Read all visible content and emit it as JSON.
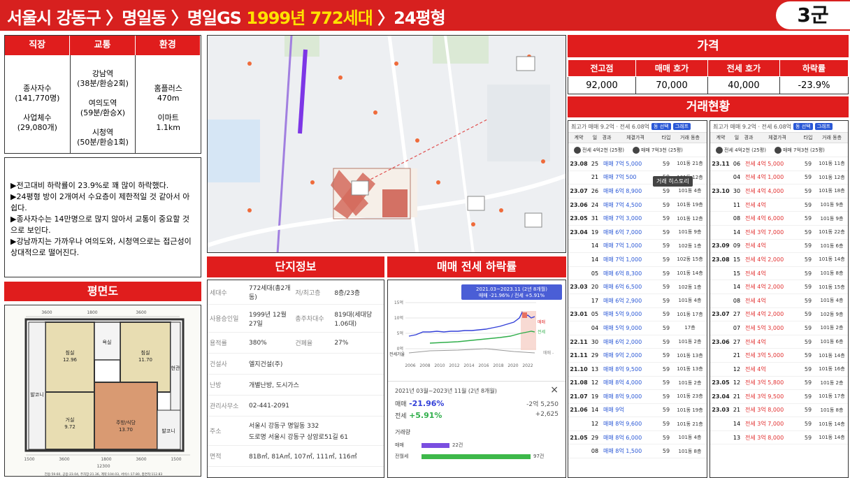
{
  "header": {
    "title_part1": "서울시 강동구 〉명일동 〉명일GS ",
    "title_highlight": "1999년 772세대",
    "title_part2": " 〉24평형",
    "group_badge": "3군"
  },
  "categories": {
    "headers": [
      "직장",
      "교통",
      "환경"
    ],
    "job": "종사자수\n(141,770명)\n\n사업체수\n(29,080개)",
    "transport": "강남역\n(38분/환승2회)\n\n여의도역\n(59분/환승X)\n\n시청역\n(50분/환승1회)",
    "environment": "홈플러스\n470m\n\n이마트\n1.1km"
  },
  "comment": {
    "lines": [
      "▶전고대비 하락률이 23.9%로 꽤 많이 하락했다.",
      "▶24평형 방이 2개여서 수요층이 제한적일 것 같아서 아쉽다.",
      "▶종사자수는 14만명으로 많지 않아서 교통이 중요할 것으로 보인다.",
      "▶강남까지는 가까우나 여의도와, 시청역으로는 접근성이 상대적으로 떨어진다."
    ]
  },
  "floorplan": {
    "heading": "평면도",
    "rooms": [
      "침실\n12.96",
      "침실\n11.70",
      "거실\n9.72",
      "주방/식당\n13.70",
      "발코니",
      "욕실",
      "현관"
    ],
    "dims_top": [
      "3600",
      "1800",
      "3600"
    ],
    "dims_bottom": [
      "1500",
      "3600",
      "1800",
      "3600",
      "1500"
    ],
    "dim_total": "12300",
    "footnote": "전용:59.60, 공용:23.04, 주차장:21.36, 계약:104.03, 서비스:17.80, 총면적:112.83"
  },
  "complex": {
    "heading": "단지정보",
    "rows": [
      {
        "k": "세대수",
        "v": "772세대(총2개동)",
        "k2": "저/최고층",
        "v2": "8층/23층"
      },
      {
        "k": "사용승인일",
        "v": "1999년 12월 27일",
        "k2": "총주차대수",
        "v2": "819대(세대당 1.06대)"
      },
      {
        "k": "용적률",
        "v": "380%",
        "k2": "건폐율",
        "v2": "27%"
      },
      {
        "k": "건설사",
        "v": "엘지건설(주)"
      },
      {
        "k": "난방",
        "v": "개별난방, 도시가스"
      },
      {
        "k": "관리사무소",
        "v": "02-441-2091"
      },
      {
        "k": "주소",
        "v": "서울시 강동구 명일동 332",
        "v_extra": "도로명 서울시 강동구 상암로51길 61"
      },
      {
        "k": "면적",
        "v": "81B㎡, 81A㎡, 107㎡, 111㎡, 116㎡"
      }
    ]
  },
  "rate": {
    "heading": "매매 전세 하락률",
    "tooltip_period": "2021.03~2023.11 (2년 8개월)",
    "tooltip_values": "매매 -21.96% / 전세 +5.91%",
    "y_ticks": [
      "15억",
      "10억",
      "5억",
      "0억"
    ],
    "x_ticks": [
      "2006",
      "2008",
      "2010",
      "2012",
      "2014",
      "2016",
      "2018",
      "2020",
      "2022"
    ],
    "legend_sale": "매매",
    "legend_jeon": "전세",
    "label_volume": "전세가율",
    "label_gap": "매매 -",
    "summary_period": "2021년 03월~2023년 11월 (2년 8개월)",
    "close_icon": "×",
    "sale_label": "매매",
    "sale_pct": "-21.96%",
    "sale_amt": "-2억 5,250",
    "jeon_label": "전세",
    "jeon_pct": "+5.91%",
    "jeon_amt": "+2,625",
    "volume_heading": "거래량",
    "vol_sale_label": "매매",
    "vol_sale_count": "22건",
    "vol_jeon_label": "전월세",
    "vol_jeon_count": "97건",
    "colors": {
      "sale": "#e23030",
      "jeon": "#2fae4a",
      "accent": "#3a5bd6"
    }
  },
  "price": {
    "heading": "가격",
    "headers": [
      "전고점",
      "매매 호가",
      "전세 호가",
      "하락률"
    ],
    "values": [
      "92,000",
      "70,000",
      "40,000",
      "-23.9%"
    ]
  },
  "deals": {
    "heading": "거래현황",
    "top_left": "최고가 매매 9.2억 · 전세 6.08억",
    "top_btn1": "동 선택",
    "top_btn2": "그래프",
    "col_headers": [
      "계약",
      "일",
      "경과",
      "체결가격",
      "타입",
      "거래 동층"
    ],
    "agent_left": [
      "전세 4억2천 (25평)",
      "매매 7억3천 (25평)"
    ],
    "tooltip": "거래 히스토리",
    "left_rows": [
      [
        "23.08",
        "25",
        "매매 7억 5,000",
        "59",
        "101동 21층"
      ],
      [
        "",
        "21",
        "매매 7억 500",
        "59",
        "101동 12층"
      ],
      [
        "23.07",
        "26",
        "매매 6억 8,900",
        "59",
        "101동 4층"
      ],
      [
        "23.06",
        "24",
        "매매 7억 4,500",
        "59",
        "101동 19층"
      ],
      [
        "23.05",
        "31",
        "매매 7억 3,000",
        "59",
        "101동 12층"
      ],
      [
        "23.04",
        "19",
        "매매 6억 7,000",
        "59",
        "101동 9층"
      ],
      [
        "",
        "14",
        "매매 7억 1,000",
        "59",
        "102동 1층"
      ],
      [
        "",
        "14",
        "매매 7억 1,000",
        "59",
        "102동 15층"
      ],
      [
        "",
        "05",
        "매매 6억 8,300",
        "59",
        "101동 14층"
      ],
      [
        "23.03",
        "20",
        "매매 6억 6,500",
        "59",
        "102동 1층"
      ],
      [
        "",
        "17",
        "매매 6억 2,900",
        "59",
        "101동 4층"
      ],
      [
        "23.01",
        "05",
        "매매 5억 9,000",
        "59",
        "101동 17층"
      ],
      [
        "",
        "04",
        "매매 5억 9,000",
        "59",
        "17층"
      ],
      [
        "22.11",
        "30",
        "매매 6억 2,000",
        "59",
        "101동 2층"
      ],
      [
        "21.11",
        "29",
        "매매 9억 2,000",
        "59",
        "101동 13층"
      ],
      [
        "21.10",
        "13",
        "매매 8억 9,500",
        "59",
        "101동 13층"
      ],
      [
        "21.08",
        "12",
        "매매 8억 4,000",
        "59",
        "101동 2층"
      ],
      [
        "21.07",
        "19",
        "매매 8억 9,000",
        "59",
        "101동 23층"
      ],
      [
        "21.06",
        "14",
        "매매 9억",
        "59",
        "101동 19층"
      ],
      [
        "",
        "12",
        "매매 8억 9,600",
        "59",
        "101동 21층"
      ],
      [
        "21.05",
        "29",
        "매매 8억 6,000",
        "59",
        "101동 4층"
      ],
      [
        "",
        "08",
        "매매 8억 1,500",
        "59",
        "101동 8층"
      ]
    ],
    "right_rows": [
      [
        "23.11",
        "06",
        "전세 4억 5,000",
        "59",
        "101동 11층"
      ],
      [
        "",
        "04",
        "전세 4억 1,000",
        "59",
        "101동 12층"
      ],
      [
        "23.10",
        "30",
        "전세 4억 4,000",
        "59",
        "101동 18층"
      ],
      [
        "",
        "11",
        "전세 4억",
        "59",
        "101동 9층"
      ],
      [
        "",
        "08",
        "전세 4억 6,000",
        "59",
        "101동 9층"
      ],
      [
        "",
        "14",
        "전세 3억 7,000",
        "59",
        "101동 22층"
      ],
      [
        "23.09",
        "09",
        "전세 4억",
        "59",
        "101동 6층"
      ],
      [
        "23.08",
        "15",
        "전세 4억 2,000",
        "59",
        "101동 14층"
      ],
      [
        "",
        "15",
        "전세 4억",
        "59",
        "101동 8층"
      ],
      [
        "",
        "14",
        "전세 4억 2,000",
        "59",
        "101동 15층"
      ],
      [
        "",
        "08",
        "전세 4억",
        "59",
        "101동 4층"
      ],
      [
        "23.07",
        "27",
        "전세 4억 2,000",
        "59",
        "102동 9층"
      ],
      [
        "",
        "07",
        "전세 5억 3,000",
        "59",
        "101동 2층"
      ],
      [
        "23.06",
        "27",
        "전세 4억",
        "59",
        "101동 6층"
      ],
      [
        "",
        "21",
        "전세 3억 5,000",
        "59",
        "101동 14층"
      ],
      [
        "",
        "12",
        "전세 4억",
        "59",
        "101동 16층"
      ],
      [
        "23.05",
        "12",
        "전세 3억 5,800",
        "59",
        "101동 2층"
      ],
      [
        "23.04",
        "21",
        "전세 3억 9,500",
        "59",
        "101동 17층"
      ],
      [
        "23.03",
        "21",
        "전세 3억 8,000",
        "59",
        "101동 8층"
      ],
      [
        "",
        "14",
        "전세 3억 7,000",
        "59",
        "101동 14층"
      ],
      [
        "",
        "13",
        "전세 3억 8,000",
        "59",
        "101동 14층"
      ]
    ]
  }
}
